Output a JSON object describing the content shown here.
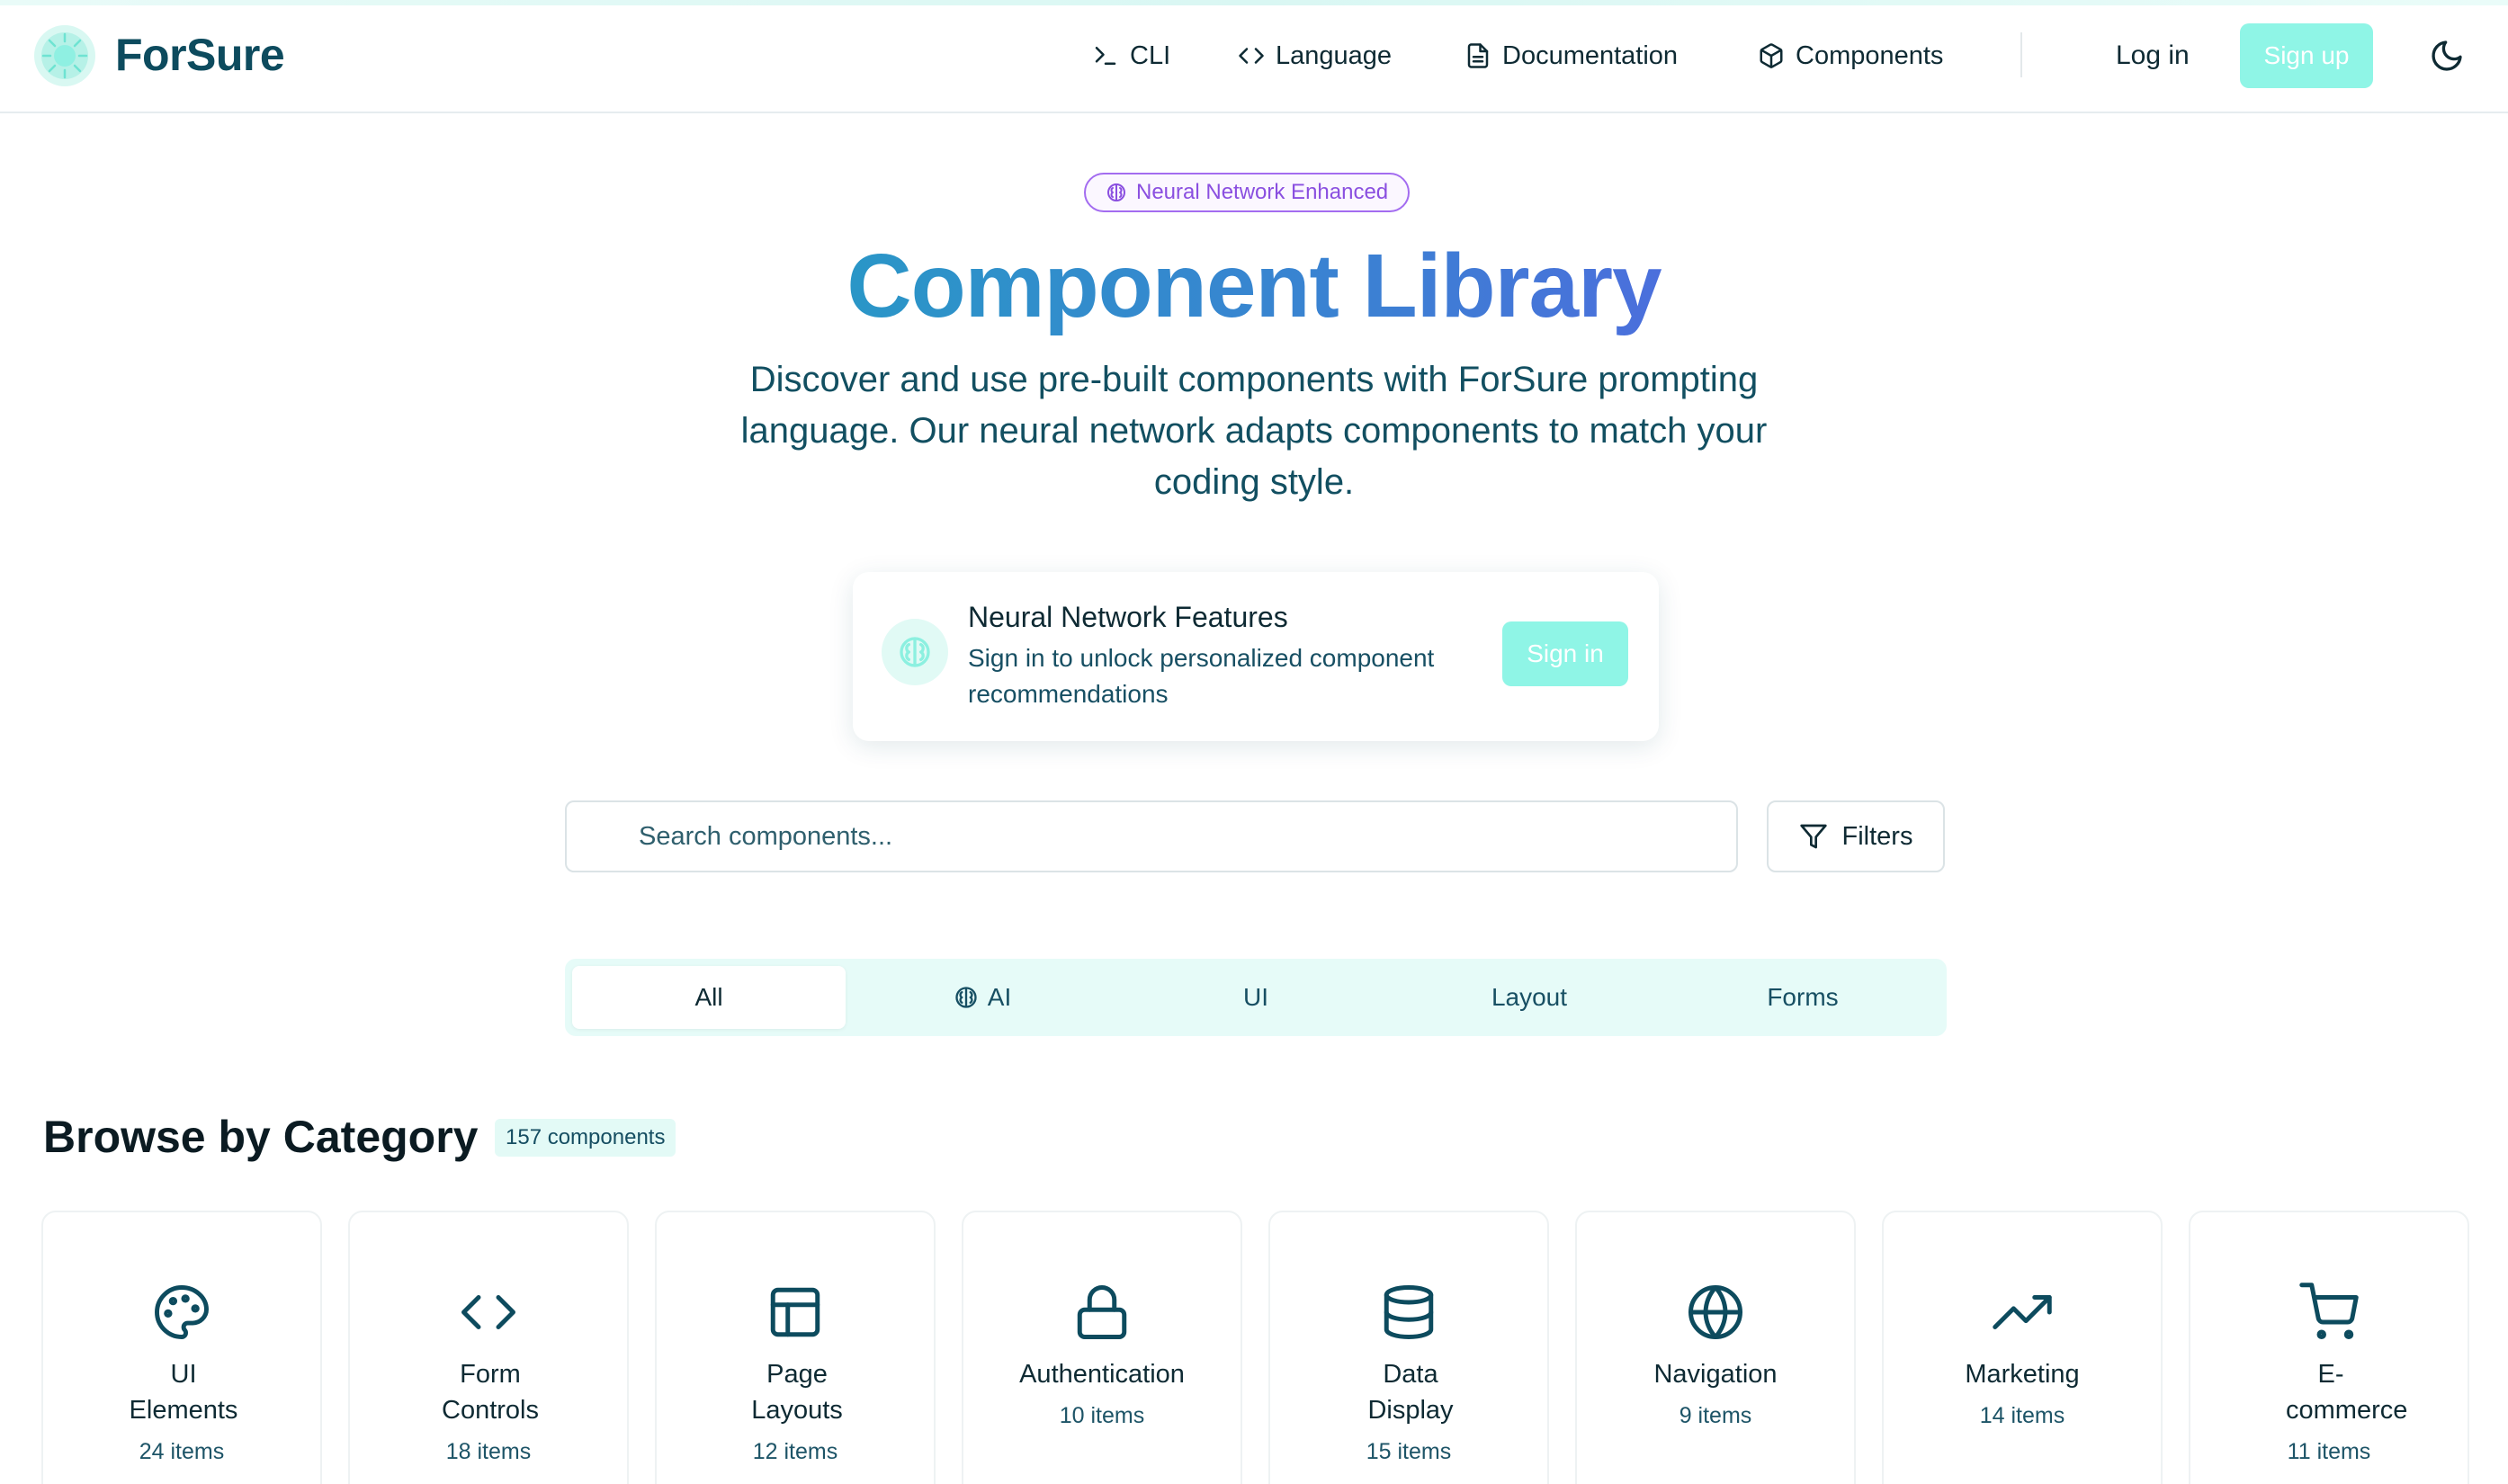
{
  "brand": {
    "name": "ForSure"
  },
  "nav": {
    "items": [
      {
        "label": "CLI",
        "icon": "terminal-icon"
      },
      {
        "label": "Language",
        "icon": "code-icon"
      },
      {
        "label": "Documentation",
        "icon": "file-text-icon"
      },
      {
        "label": "Components",
        "icon": "box-icon"
      }
    ],
    "login": "Log in",
    "signup": "Sign up",
    "theme_toggle_icon": "moon-icon"
  },
  "hero": {
    "badge": "Neural Network Enhanced",
    "title": "Component Library",
    "subtitle": "Discover and use pre-built components with ForSure prompting language. Our neural network adapts components to match your coding style."
  },
  "neural_card": {
    "title": "Neural Network Features",
    "description": "Sign in to unlock personalized component recommendations",
    "button": "Sign in"
  },
  "search": {
    "placeholder": "Search components...",
    "filters_label": "Filters"
  },
  "tabs": [
    {
      "label": "All",
      "active": true
    },
    {
      "label": "AI",
      "icon": "brain-icon"
    },
    {
      "label": "UI"
    },
    {
      "label": "Layout"
    },
    {
      "label": "Forms"
    }
  ],
  "browse": {
    "title": "Browse by Category",
    "count": "157 components",
    "categories": [
      {
        "name": "UI Elements",
        "count": "24 items",
        "icon": "palette-icon"
      },
      {
        "name": "Form Controls",
        "count": "18 items",
        "icon": "code-icon"
      },
      {
        "name": "Page Layouts",
        "count": "12 items",
        "icon": "layout-icon"
      },
      {
        "name": "Authentication",
        "count": "10 items",
        "icon": "lock-icon"
      },
      {
        "name": "Data Display",
        "count": "15 items",
        "icon": "database-icon"
      },
      {
        "name": "Navigation",
        "count": "9 items",
        "icon": "globe-icon"
      },
      {
        "name": "Marketing",
        "count": "14 items",
        "icon": "trending-up-icon"
      },
      {
        "name": "E-commerce",
        "count": "11 items",
        "icon": "shopping-cart-icon"
      }
    ]
  },
  "colors": {
    "brand": "#0d4b5e",
    "accent": "#8ff5e6",
    "badge_purple": "#8a4fe0",
    "gradient_start": "#2a96c7",
    "gradient_end": "#4b6fdc"
  }
}
